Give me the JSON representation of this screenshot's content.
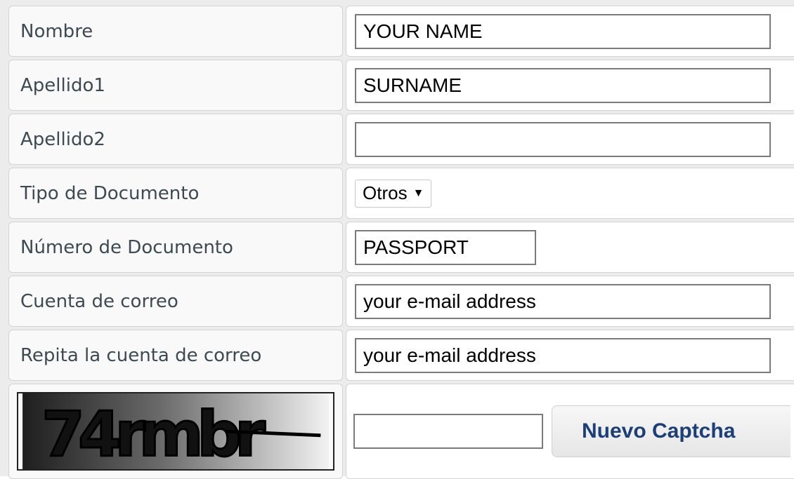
{
  "form": {
    "fields": {
      "nombre": {
        "label": "Nombre",
        "value": "YOUR NAME"
      },
      "apellido1": {
        "label": "Apellido1",
        "value": "SURNAME"
      },
      "apellido2": {
        "label": "Apellido2",
        "value": ""
      },
      "tipo_documento": {
        "label": "Tipo de Documento",
        "selected": "Otros"
      },
      "numero_documento": {
        "label": "Número de Documento",
        "value": "PASSPORT"
      },
      "cuenta_correo": {
        "label": "Cuenta de correo",
        "value": "your e-mail address"
      },
      "repita_correo": {
        "label": "Repita la cuenta de correo",
        "value": "your e-mail address"
      }
    },
    "captcha": {
      "image_text": "74rmbr",
      "input_value": "",
      "button_label": "Nuevo Captcha"
    }
  },
  "colors": {
    "label_text": "#3d4a52",
    "button_text": "#1d3f78",
    "cell_border": "#d4d4d4"
  },
  "icons": {
    "dropdown": "caret-down-icon"
  }
}
